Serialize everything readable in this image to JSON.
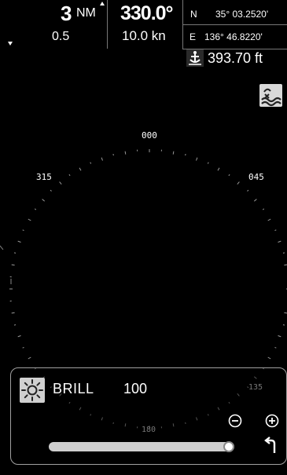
{
  "header": {
    "range": "3",
    "range_unit": "NM",
    "range_rings": "0.5",
    "heading": "330.0°",
    "speed": "10.0 kn",
    "lat_label": "N",
    "lat_value": "35° 03.2520'",
    "lon_label": "E",
    "lon_value": "136° 46.8220'",
    "depth": "393.70 ft"
  },
  "radar": {
    "labels": {
      "north": "000",
      "nw": "315",
      "ne": "045",
      "se": "135",
      "south": "180"
    }
  },
  "panel": {
    "brill_label": "BRILL",
    "brill_value": "100",
    "brill_level": 0.97
  },
  "icons": {
    "wave": "wave-alarm-icon",
    "depth": "depth-anchor-icon",
    "brightness": "sun-icon",
    "zoom_out": "minus-circle-icon",
    "zoom_in": "plus-circle-icon",
    "back": "return-arrow-icon"
  }
}
